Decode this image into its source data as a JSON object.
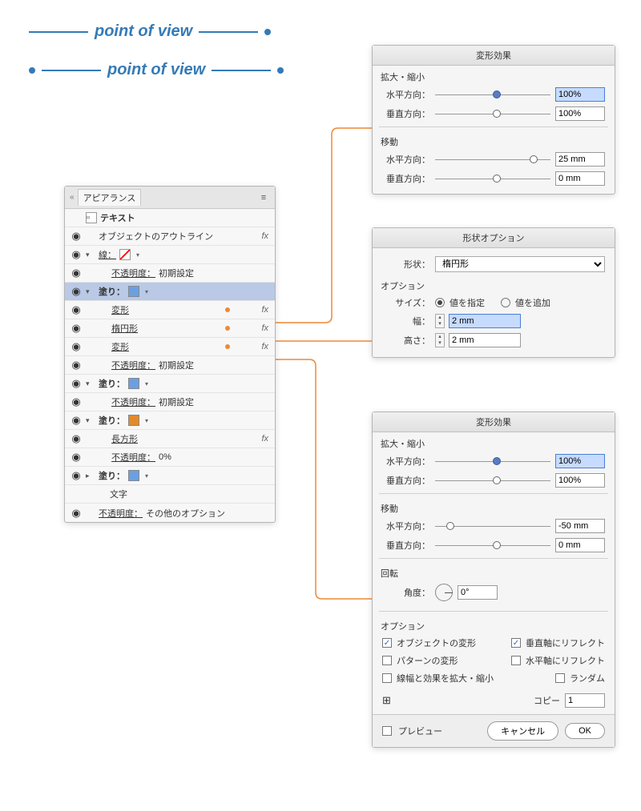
{
  "pov_text": "point of view",
  "appearance": {
    "tab": "アピアランス",
    "rows": {
      "text": "テキスト",
      "outline": "オブジェクトのアウトライン",
      "stroke": "線：",
      "opacity": "不透明度：",
      "default": "初期設定",
      "fill": "塗り：",
      "transform": "変形",
      "ellipse": "楕円形",
      "rect": "長方形",
      "opacity0": "0%",
      "char": "文字",
      "otheropt": "その他のオプション"
    }
  },
  "colors": {
    "fill1": "#6aa0e2",
    "fill2": "#6aa0e2",
    "fill3": "#e28a2b",
    "fill4": "#6aa0e2"
  },
  "dlg1": {
    "title": "変形効果",
    "scale": "拡大・縮小",
    "h": "水平方向：",
    "v": "垂直方向：",
    "h_val": "100%",
    "v_val": "100%",
    "move": "移動",
    "mh_val": "25 mm",
    "mv_val": "0 mm"
  },
  "dlg2": {
    "title": "形状オプション",
    "shape_lab": "形状：",
    "shape_val": "楕円形",
    "options": "オプション",
    "size": "サイズ：",
    "r1": "値を指定",
    "r2": "値を追加",
    "width": "幅：",
    "height": "高さ：",
    "w_val": "2 mm",
    "h_val": "2 mm"
  },
  "dlg3": {
    "title": "変形効果",
    "scale": "拡大・縮小",
    "h": "水平方向：",
    "v": "垂直方向：",
    "h_val": "100%",
    "v_val": "100%",
    "move": "移動",
    "mh_val": "-50 mm",
    "mv_val": "0 mm",
    "rot": "回転",
    "angle": "角度：",
    "angle_v": "0°",
    "options": "オプション",
    "c1": "オブジェクトの変形",
    "c2": "垂直軸にリフレクト",
    "c3": "パターンの変形",
    "c4": "水平軸にリフレクト",
    "c5": "線幅と効果を拡大・縮小",
    "c6": "ランダム",
    "copy": "コピー",
    "copy_v": "1",
    "preview": "プレビュー",
    "cancel": "キャンセル",
    "ok": "OK"
  }
}
